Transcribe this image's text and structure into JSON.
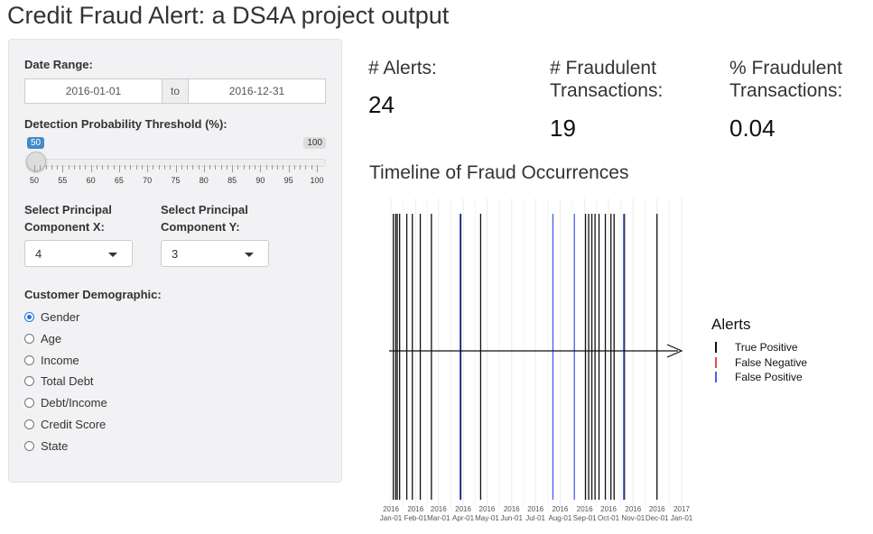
{
  "page_title": "Credit Fraud Alert: a DS4A project output",
  "sidebar": {
    "date_range_label": "Date Range:",
    "date_start": "2016-01-01",
    "date_sep": "to",
    "date_end": "2016-12-31",
    "threshold_label": "Detection Probability Threshold (%):",
    "slider": {
      "min": 50,
      "max": 100,
      "value": 50,
      "min_label": "50",
      "max_label": "100",
      "tick_labels": [
        "50",
        "55",
        "60",
        "65",
        "70",
        "75",
        "80",
        "85",
        "90",
        "95",
        "100"
      ]
    },
    "pcx_label_1": "Select Principal",
    "pcx_label_2": "Component X:",
    "pcx_value": "4",
    "pcy_label_1": "Select Principal",
    "pcy_label_2": "Component Y:",
    "pcy_value": "3",
    "demographic_label": "Customer Demographic:",
    "demographics": [
      "Gender",
      "Age",
      "Income",
      "Total Debt",
      "Debt/Income",
      "Credit Score",
      "State"
    ],
    "demographic_selected": "Gender"
  },
  "kpis": {
    "alerts_label": "# Alerts:",
    "alerts_value": "24",
    "fraud_label_1": "# Fraudulent",
    "fraud_label_2": "Transactions:",
    "fraud_value": "19",
    "pct_label_1": "% Fraudulent",
    "pct_label_2": "Transactions:",
    "pct_value": "0.04"
  },
  "timeline_title": "Timeline of Fraud Occurrences",
  "chart_data": {
    "type": "timeline",
    "x_range": [
      "2016-01-01",
      "2017-01-01"
    ],
    "tick_labels": [
      {
        "date": "2016-01-01",
        "line1": "2016",
        "line2": "Jan-01"
      },
      {
        "date": "2016-02-01",
        "line1": "2016",
        "line2": "Feb-01"
      },
      {
        "date": "2016-03-01",
        "line1": "2016",
        "line2": "Mar-01"
      },
      {
        "date": "2016-04-01",
        "line1": "2016",
        "line2": "Apr-01"
      },
      {
        "date": "2016-05-01",
        "line1": "2016",
        "line2": "May-01"
      },
      {
        "date": "2016-06-01",
        "line1": "2016",
        "line2": "Jun-01"
      },
      {
        "date": "2016-07-01",
        "line1": "2016",
        "line2": "Jul-01"
      },
      {
        "date": "2016-08-01",
        "line1": "2016",
        "line2": "Aug-01"
      },
      {
        "date": "2016-09-01",
        "line1": "2016",
        "line2": "Sep-01"
      },
      {
        "date": "2016-10-01",
        "line1": "2016",
        "line2": "Oct-01"
      },
      {
        "date": "2016-11-01",
        "line1": "2016",
        "line2": "Nov-01"
      },
      {
        "date": "2016-12-01",
        "line1": "2016",
        "line2": "Dec-01"
      },
      {
        "date": "2017-01-01",
        "line1": "2017",
        "line2": "Jan-01"
      }
    ],
    "legend_title": "Alerts",
    "series": [
      {
        "name": "True Positive",
        "color": "#111111",
        "dates": [
          "2016-01-04",
          "2016-01-07",
          "2016-01-09",
          "2016-01-12",
          "2016-01-21",
          "2016-01-28",
          "2016-02-07",
          "2016-02-21",
          "2016-03-29",
          "2016-04-23",
          "2016-09-02",
          "2016-09-06",
          "2016-09-10",
          "2016-09-14",
          "2016-09-19",
          "2016-09-27",
          "2016-10-04",
          "2016-10-08",
          "2016-10-21",
          "2016-12-01"
        ]
      },
      {
        "name": "False Negative",
        "color": "#e05050",
        "dates": []
      },
      {
        "name": "False Positive",
        "color": "#4a5ee8",
        "dates": [
          "2016-03-28",
          "2016-07-23",
          "2016-08-19",
          "2016-10-20"
        ]
      }
    ]
  }
}
